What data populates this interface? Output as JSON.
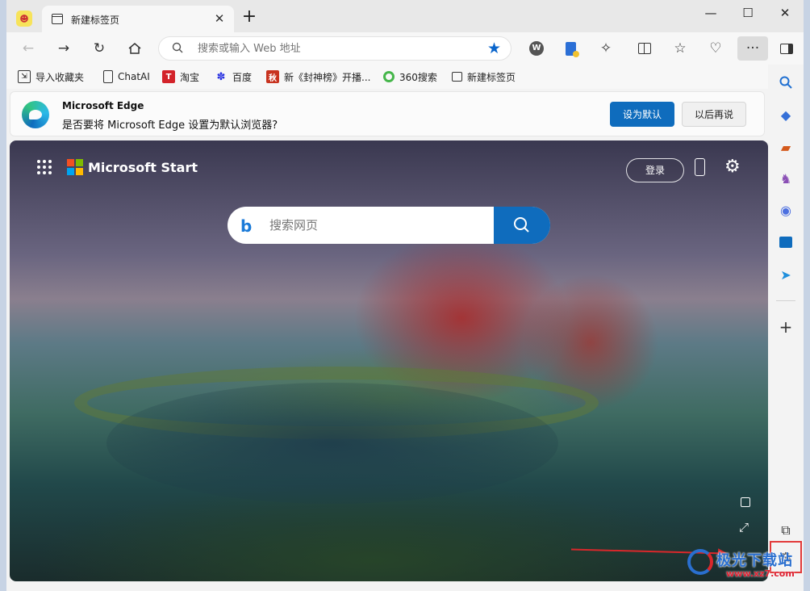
{
  "titlebar": {
    "tab_title": "新建标签页",
    "tab_close": "✕",
    "new_tab": "+",
    "minimize": "—",
    "maximize": "☐",
    "close": "✕"
  },
  "toolbar": {
    "address_placeholder": "搜索或输入 Web 地址",
    "more": "···"
  },
  "favorites": [
    {
      "label": "导入收藏夹",
      "icon": "import-icon"
    },
    {
      "label": "ChatAI",
      "icon": "page-icon"
    },
    {
      "label": "淘宝",
      "icon": "taobao-icon"
    },
    {
      "label": "百度",
      "icon": "baidu-icon"
    },
    {
      "label": "新《封神榜》开播...",
      "icon": "video-icon"
    },
    {
      "label": "360搜索",
      "icon": "360-icon"
    },
    {
      "label": "新建标签页",
      "icon": "newtab-icon"
    }
  ],
  "infobar": {
    "title": "Microsoft Edge",
    "message": "是否要将 Microsoft Edge 设置为默认浏览器?",
    "primary_button": "设为默认",
    "secondary_button": "以后再说"
  },
  "newtab": {
    "brand": "Microsoft Start",
    "login": "登录",
    "search_placeholder": "搜索网页",
    "bing_glyph": "b"
  },
  "sidebar": {
    "add": "+"
  },
  "watermark": {
    "text": "极光下载站",
    "url": "www.xz7.com"
  },
  "colors": {
    "accent": "#0f6cbd",
    "highlight": "#e23a3a"
  }
}
